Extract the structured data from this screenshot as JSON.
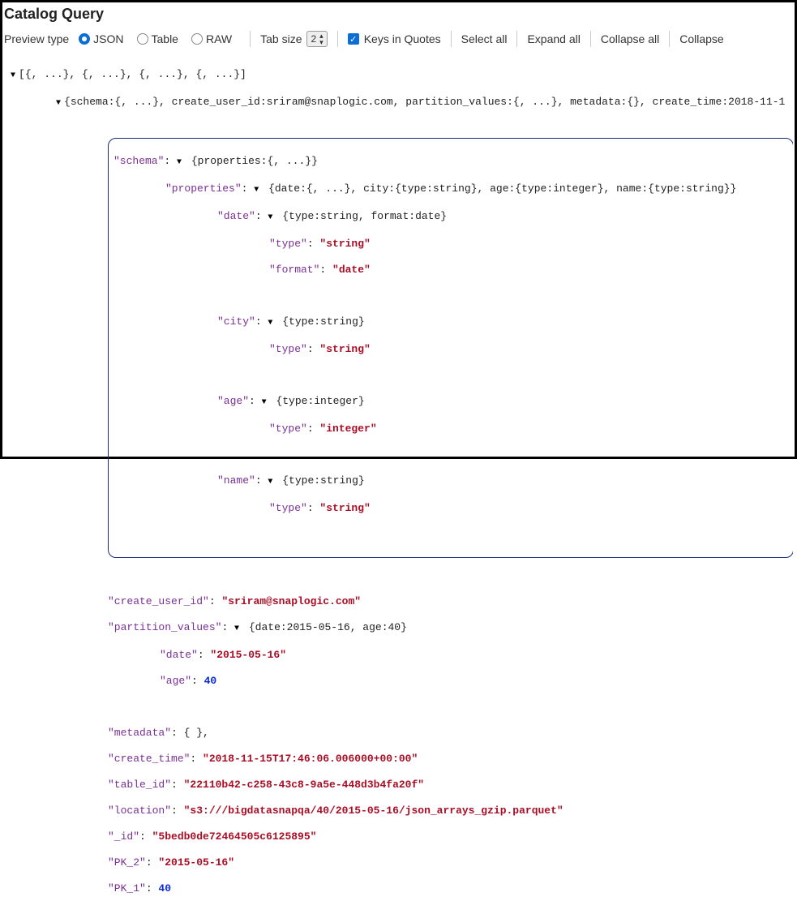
{
  "title": "Catalog Query",
  "toolbar": {
    "preview_type_label": "Preview type",
    "radios": {
      "json": "JSON",
      "table": "Table",
      "raw": "RAW"
    },
    "tabsize_label": "Tab size",
    "tabsize_value": "2",
    "keys_in_quotes": "Keys in Quotes",
    "actions": {
      "select_all": "Select all",
      "expand_all": "Expand all",
      "collapse_all": "Collapse all",
      "collapse": "Collapse"
    }
  },
  "tree": {
    "header_row": "[{, ...}, {, ...}, {, ...}, {, ...}]",
    "row_obj_summary": "{schema:{, ...}, create_user_id:sriram@snaplogic.com, partition_values:{, ...}, metadata:{}, create_time:2018-11-1",
    "schema_key": "\"schema\"",
    "schema_summary": "{properties:{, ...}}",
    "props_key": "\"properties\"",
    "props_summary": "{date:{, ...}, city:{type:string}, age:{type:integer}, name:{type:string}}",
    "date_key": "\"date\"",
    "date_summary": "{type:string, format:date}",
    "date_type_k": "\"type\"",
    "date_type_v": "\"string\"",
    "date_format_k": "\"format\"",
    "date_format_v": "\"date\"",
    "city_key": "\"city\"",
    "city_summary": "{type:string}",
    "city_type_k": "\"type\"",
    "city_type_v": "\"string\"",
    "age_key": "\"age\"",
    "age_summary": "{type:integer}",
    "age_type_k": "\"type\"",
    "age_type_v": "\"integer\"",
    "name_key": "\"name\"",
    "name_summary": "{type:string}",
    "name_type_k": "\"type\"",
    "name_type_v": "\"string\"",
    "create_user_id_k": "\"create_user_id\"",
    "create_user_id_v": "\"sriram@snaplogic.com\"",
    "partition_values_k": "\"partition_values\"",
    "partition_values_summary": "{date:2015-05-16, age:40}",
    "pv_date_k": "\"date\"",
    "pv_date_v": "\"2015-05-16\"",
    "pv_age_k": "\"age\"",
    "pv_age_v": "40",
    "metadata_k": "\"metadata\"",
    "metadata_v": "{ },",
    "create_time_k": "\"create_time\"",
    "create_time_v": "\"2018-11-15T17:46:06.006000+00:00\"",
    "table_id_k": "\"table_id\"",
    "table_id_v": "\"22110b42-c258-43c8-9a5e-448d3b4fa20f\"",
    "location_k": "\"location\"",
    "location_v": "\"s3:///bigdatasnapqa/40/2015-05-16/json_arrays_gzip.parquet\"",
    "id_k": "\"_id\"",
    "id_v": "\"5bedb0de72464505c6125895\"",
    "pk2_k": "\"PK_2\"",
    "pk2_v": "\"2015-05-16\"",
    "pk1_k": "\"PK_1\"",
    "pk1_v": "40"
  }
}
